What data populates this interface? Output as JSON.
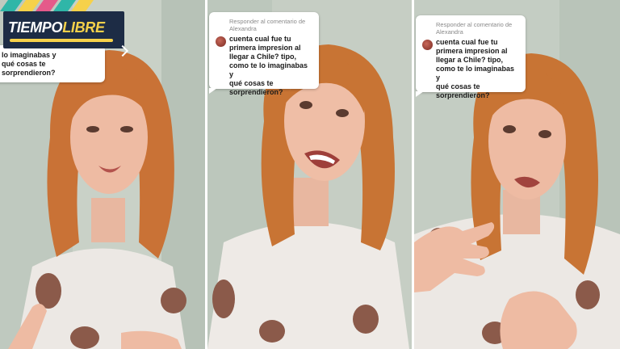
{
  "brand": {
    "word1": "TIEMPO",
    "word2": "LIBRE"
  },
  "panels": [
    {
      "comment_header": "",
      "question": "lo imaginabas y\nqué cosas te\nsorprendieron?"
    },
    {
      "comment_header": "Responder al comentario de\nAlexandra",
      "question": "cuenta cual fue tu\nprimera impresion al\nllegar a Chile? tipo,\ncomo te lo imaginabas y\nqué cosas te\nsorprendieron?"
    },
    {
      "comment_header": "Responder al comentario de\nAlexandra",
      "question": "cuenta cual fue tu\nprimera impresion al\nllegar a Chile? tipo,\ncomo te lo imaginabas y\nqué cosas te\nsorprendieron?"
    }
  ]
}
